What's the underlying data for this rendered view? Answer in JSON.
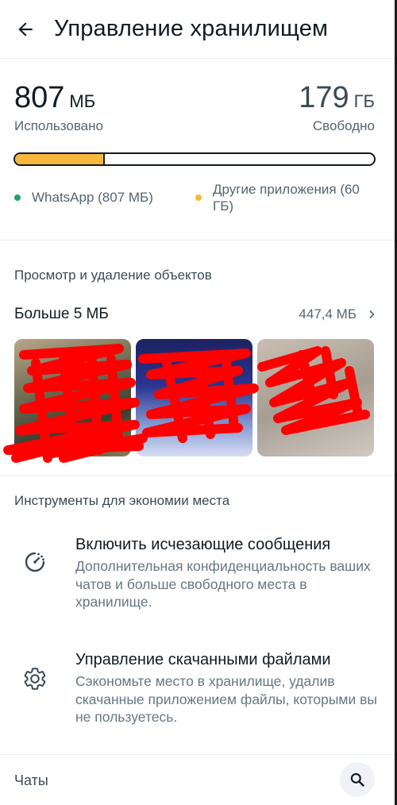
{
  "header": {
    "back_icon": "arrow-left-icon",
    "title": "Управление хранилищем"
  },
  "storage": {
    "used_value": "807",
    "used_unit": "МБ",
    "used_label": "Использовано",
    "free_value": "179",
    "free_unit": "ГБ",
    "free_label": "Свободно",
    "usage_fraction": 0.25,
    "legend": [
      {
        "label": "WhatsApp (807 МБ)",
        "color": "#21a366"
      },
      {
        "label": "Другие приложения (60 ГБ)",
        "color": "#f6b73c"
      }
    ]
  },
  "review": {
    "section_title": "Просмотр и удаление объектов",
    "large_files_label": "Больше 5 МБ",
    "large_files_size": "447,4 МБ",
    "chevron_icon": "chevron-right-icon"
  },
  "tools": {
    "section_title": "Инструменты для экономии места",
    "items": [
      {
        "icon": "timer-icon",
        "title": "Включить исчезающие сообщения",
        "description": "Дополнительная конфиденциальность ваших чатов и больше свободного места в хранилище."
      },
      {
        "icon": "gear-icon",
        "title": "Управление скачанными файлами",
        "description": "Сэкономьте место в хранилище, удалив скачанные приложением файлы, которыми вы не пользуетесь."
      }
    ]
  },
  "chats": {
    "label": "Чаты",
    "search_icon": "search-icon"
  },
  "colors": {
    "accent_used": "#f6b73c",
    "whatsapp_dot": "#21a366",
    "redaction": "#ff0000"
  }
}
